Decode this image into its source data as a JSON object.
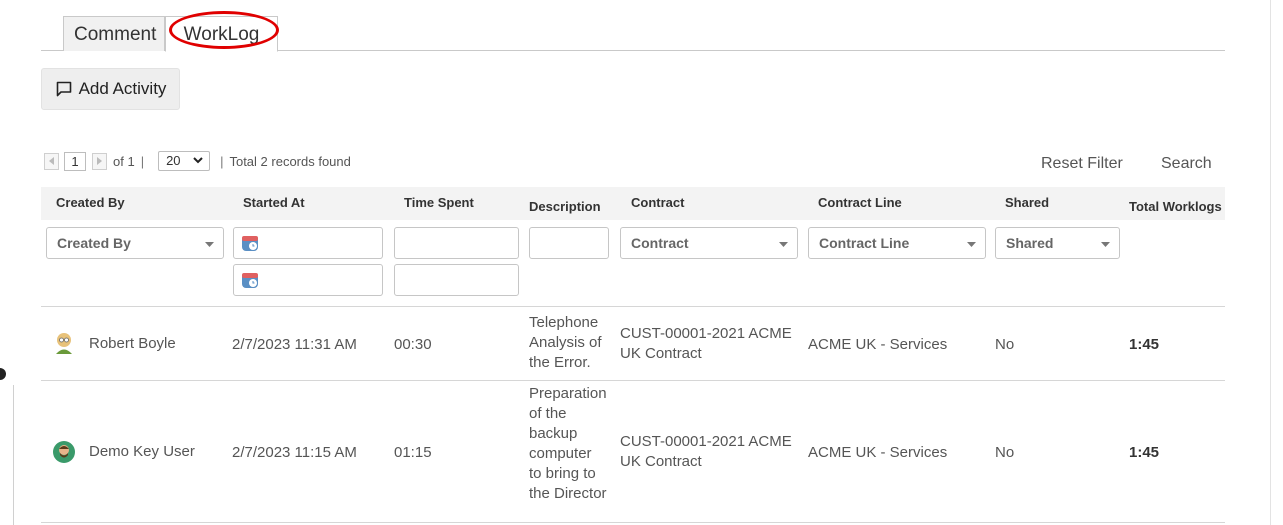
{
  "tabs": [
    {
      "label": "Comment",
      "active": false
    },
    {
      "label": "WorkLog",
      "active": true
    }
  ],
  "add_activity": {
    "label": "Add Activity",
    "icon": "chat-bubble-icon"
  },
  "pager": {
    "page": "1",
    "of_text": "of 1",
    "separator": "|",
    "page_size": "20",
    "total_text": "Total 2 records found"
  },
  "actions": {
    "reset_filter": "Reset Filter",
    "search": "Search"
  },
  "columns": {
    "created_by": "Created By",
    "started_at": "Started At",
    "time_spent": "Time Spent",
    "description": "Description",
    "contract": "Contract",
    "contract_line": "Contract Line",
    "shared": "Shared",
    "total_worklogs": "Total Worklogs"
  },
  "filters": {
    "created_by": "Created By",
    "contract": "Contract",
    "contract_line": "Contract Line",
    "shared": "Shared"
  },
  "rows": [
    {
      "created_by": "Robert Boyle",
      "started_at": "2/7/2023 11:31 AM",
      "time_spent": "00:30",
      "description": [
        "Telephone",
        "Analysis of",
        "the Error."
      ],
      "contract": [
        "CUST-00001-2021 ACME",
        "UK Contract"
      ],
      "contract_line": "ACME UK - Services",
      "shared": "No",
      "total_worklogs": "1:45"
    },
    {
      "created_by": "Demo Key User",
      "started_at": "2/7/2023 11:15 AM",
      "time_spent": "01:15",
      "description": [
        "Preparation",
        "of the",
        "backup",
        "computer",
        "to bring to",
        "the Director"
      ],
      "contract": [
        "CUST-00001-2021 ACME",
        "UK Contract"
      ],
      "contract_line": "ACME UK - Services",
      "shared": "No",
      "total_worklogs": "1:45"
    }
  ],
  "colors": {
    "annotation": "#e00000",
    "header_bg": "#f3f3f3",
    "button_bg": "#eeeeee"
  }
}
